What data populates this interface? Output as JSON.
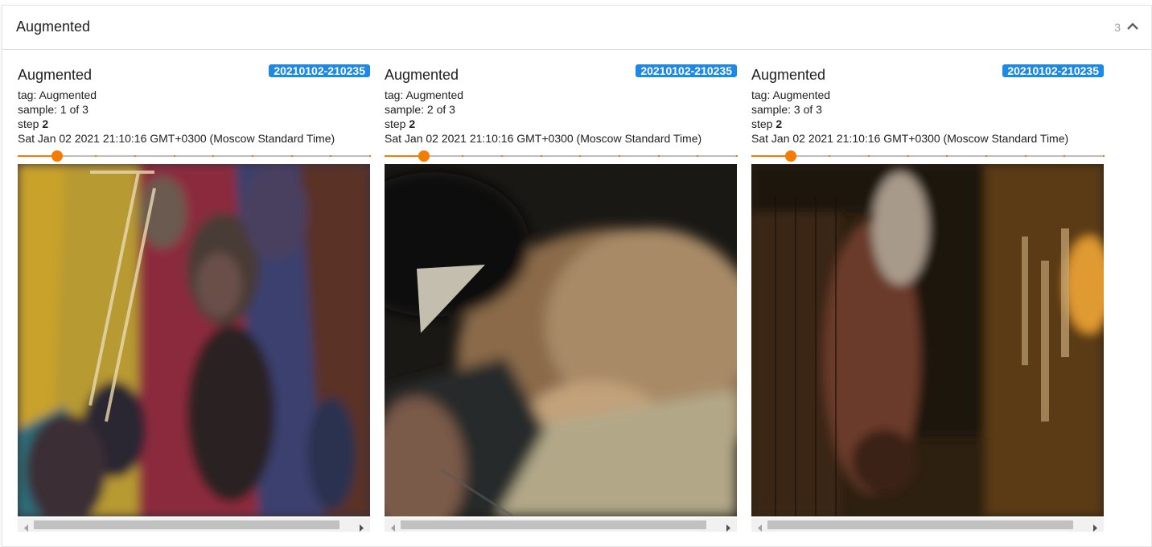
{
  "pane": {
    "title": "Augmented",
    "count": "3",
    "collapse_icon": "chevron-up-icon"
  },
  "cards": [
    {
      "title": "Augmented",
      "run": "20210102-210235",
      "tag": "tag: Augmented",
      "sample": "sample: 1 of 3",
      "step_label": "step",
      "step_value": "2",
      "timestamp": "Sat Jan 02 2021 21:10:16 GMT+0300 (Moscow Standard Time)",
      "slider_fraction": 0.111
    },
    {
      "title": "Augmented",
      "run": "20210102-210235",
      "tag": "tag: Augmented",
      "sample": "sample: 2 of 3",
      "step_label": "step",
      "step_value": "2",
      "timestamp": "Sat Jan 02 2021 21:10:16 GMT+0300 (Moscow Standard Time)",
      "slider_fraction": 0.111
    },
    {
      "title": "Augmented",
      "run": "20210102-210235",
      "tag": "tag: Augmented",
      "sample": "sample: 3 of 3",
      "step_label": "step",
      "step_value": "2",
      "timestamp": "Sat Jan 02 2021 21:10:16 GMT+0300 (Moscow Standard Time)",
      "slider_fraction": 0.111
    }
  ],
  "colors": {
    "accent_orange": "#f57c00",
    "badge_blue": "#1e88e5"
  }
}
